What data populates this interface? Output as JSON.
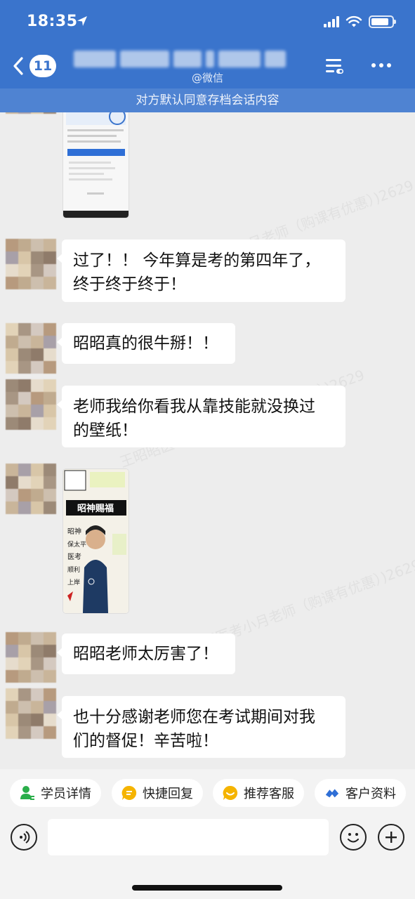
{
  "status_bar": {
    "time": "18:35"
  },
  "header": {
    "back_badge": "11",
    "subtitle": "@微信",
    "archive_notice": "对方默认同意存档会话内容"
  },
  "watermark_text": "王昭昭医考小月老师（购课有优惠）)2629",
  "messages": [
    {
      "type": "image",
      "content": "phone-screenshot"
    },
    {
      "type": "text",
      "line1": "过了！！ 今年算是考的第四年了，",
      "line2": "终于终于终于！"
    },
    {
      "type": "text",
      "line1": "昭昭真的很牛掰！！"
    },
    {
      "type": "text",
      "line1": "老师我给你看我从靠技能就没换过",
      "line2": "的壁纸！"
    },
    {
      "type": "image",
      "content": "wallpaper-poster",
      "poster_title": "昭神赐福",
      "poster_side": "昭神\n保太平\n医考\n顺利\n上岸\n！"
    },
    {
      "type": "text",
      "line1": "昭昭老师太厉害了！"
    },
    {
      "type": "text",
      "line1": "也十分感谢老师您在考试期间对我",
      "line2": "们的督促！辛苦啦！"
    }
  ],
  "quick_actions": [
    {
      "label": "学员详情",
      "icon": "user-detail-icon",
      "color": "#2aae4a"
    },
    {
      "label": "快捷回复",
      "icon": "quick-reply-icon",
      "color": "#f5b400"
    },
    {
      "label": "推荐客服",
      "icon": "recommend-service-icon",
      "color": "#f5b400"
    },
    {
      "label": "客户资料",
      "icon": "customer-info-icon",
      "color": "#2f6fd6"
    }
  ],
  "input": {
    "value": "",
    "placeholder": ""
  },
  "colors": {
    "header": "#3a74cc",
    "archive_bar": "#4f83d2",
    "chat_bg": "#ededed",
    "bubble": "#ffffff"
  }
}
